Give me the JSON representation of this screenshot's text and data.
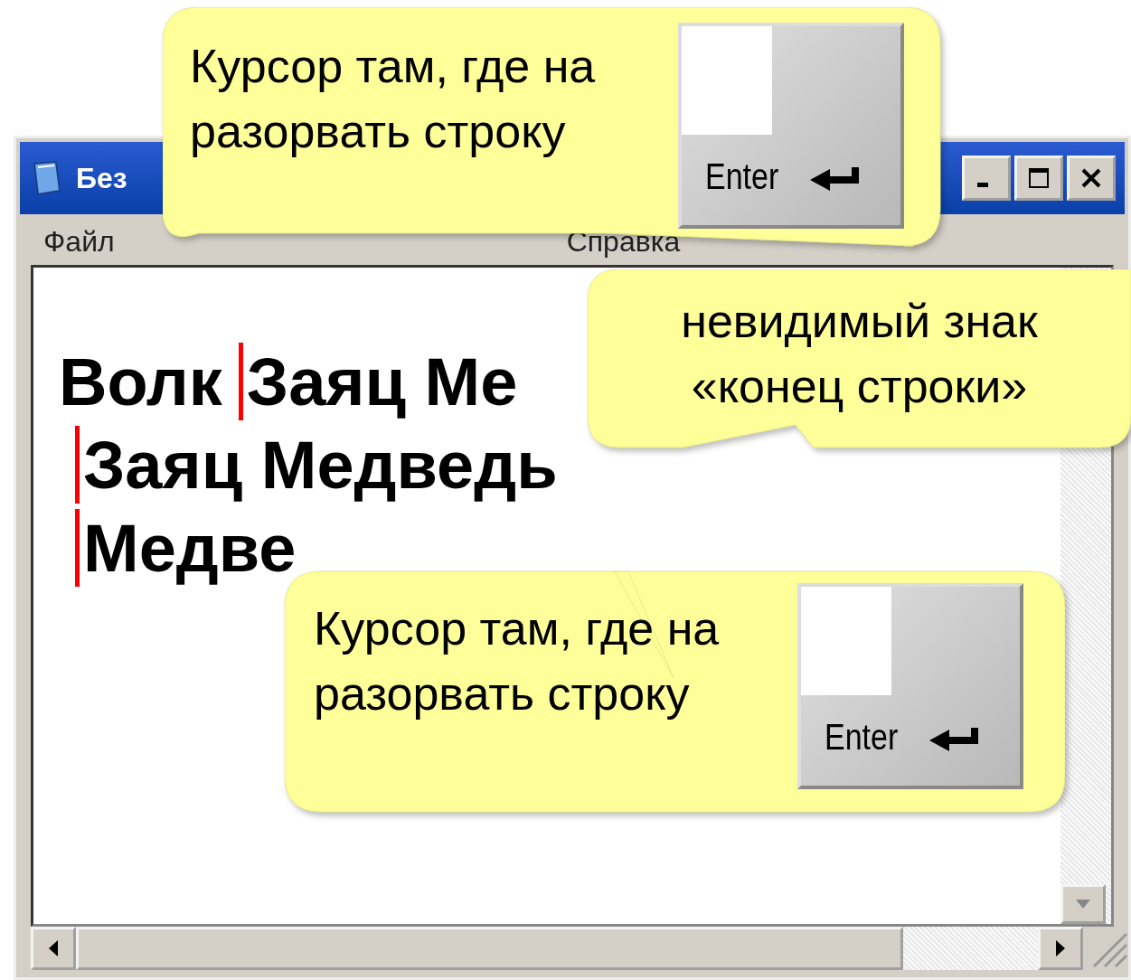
{
  "window": {
    "title": "Без",
    "menu": [
      {
        "label": "Файл"
      },
      {
        "label": "Справка"
      }
    ]
  },
  "document": {
    "lines": [
      {
        "before": "Волк",
        "after": "Заяц Ме"
      },
      {
        "after": "Заяц Медведь"
      },
      {
        "after": "Медве"
      }
    ]
  },
  "callouts": [
    {
      "lines": [
        "Курсор там, где на",
        "разорвать строку"
      ],
      "key": {
        "label": "Enter"
      }
    },
    {
      "lines": [
        "невидимый знак",
        "«конец строки»"
      ]
    },
    {
      "lines": [
        "Курсор там, где на",
        "разорвать строку"
      ],
      "key": {
        "label": "Enter"
      }
    }
  ]
}
